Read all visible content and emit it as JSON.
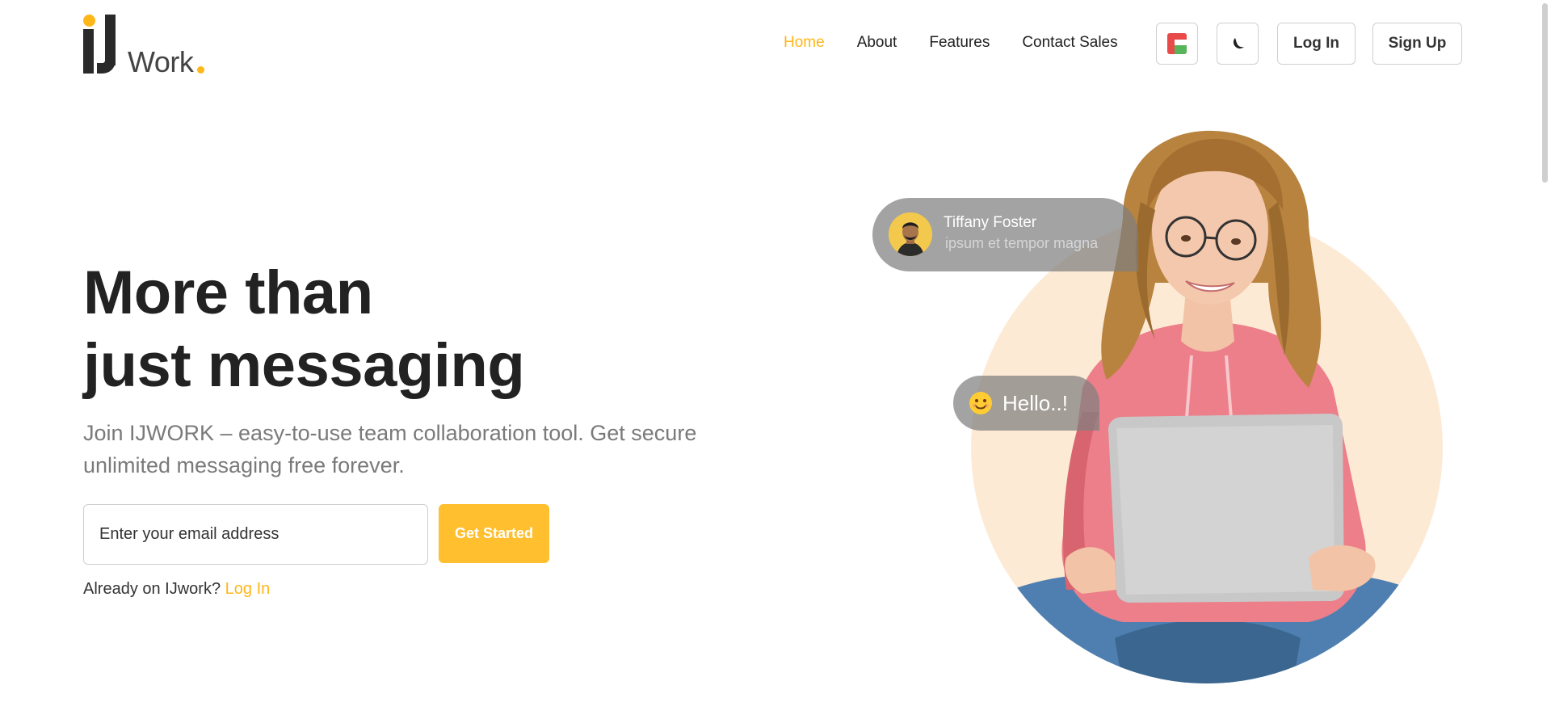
{
  "header": {
    "logo_text": "Work",
    "nav": [
      {
        "label": "Home",
        "active": true
      },
      {
        "label": "About",
        "active": false
      },
      {
        "label": "Features",
        "active": false
      },
      {
        "label": "Contact Sales",
        "active": false
      }
    ],
    "language_icon": "flag-icon",
    "theme_icon": "moon-icon",
    "login_label": "Log In",
    "signup_label": "Sign Up"
  },
  "hero": {
    "title_line1": "More than",
    "title_line2": "just messaging",
    "subtitle": "Join IJWORK – easy-to-use team collaboration tool. Get secure unlimited messaging free forever.",
    "email_placeholder": "Enter your email address",
    "cta_label": "Get Started",
    "already_text": "Already on IJwork?",
    "already_link": "Log In"
  },
  "illustration": {
    "chat_name": "Tiffany Foster",
    "chat_message": "ipsum et tempor magna",
    "hello_text": "Hello..!",
    "hello_icon": "smile-emoji-icon"
  },
  "colors": {
    "accent": "#ffb619",
    "cta": "#ffbf2f",
    "peach": "#fdead5",
    "text_dark": "#222222",
    "text_muted": "#7a7a7a"
  }
}
